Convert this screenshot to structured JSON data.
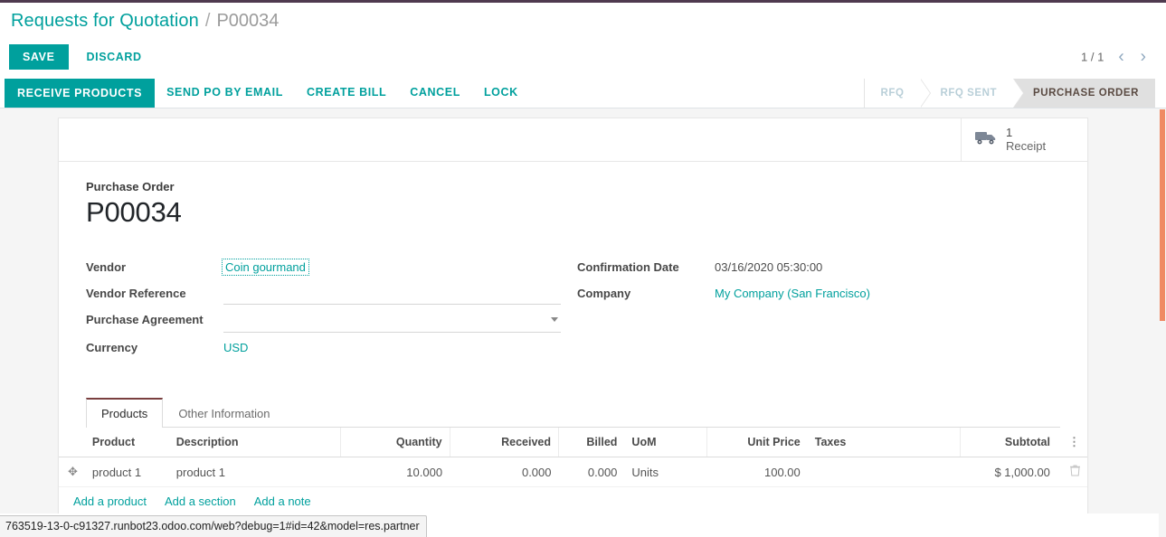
{
  "breadcrumb": {
    "parent": "Requests for Quotation",
    "separator": "/",
    "current": "P00034"
  },
  "controls": {
    "save_label": "SAVE",
    "discard_label": "DISCARD",
    "pager_text": "1 / 1",
    "prev_icon": "‹",
    "next_icon": "›"
  },
  "action_bar": {
    "buttons": [
      {
        "label": "RECEIVE PRODUCTS",
        "primary": true
      },
      {
        "label": "SEND PO BY EMAIL",
        "primary": false
      },
      {
        "label": "CREATE BILL",
        "primary": false
      },
      {
        "label": "CANCEL",
        "primary": false
      },
      {
        "label": "LOCK",
        "primary": false
      }
    ]
  },
  "statusbar": {
    "stages": [
      {
        "label": "RFQ",
        "active": false
      },
      {
        "label": "RFQ SENT",
        "active": false
      },
      {
        "label": "PURCHASE ORDER",
        "active": true
      }
    ]
  },
  "smart_buttons": [
    {
      "icon": "truck-icon",
      "value": "1",
      "label": "Receipt"
    }
  ],
  "title": {
    "label": "Purchase Order",
    "value": "P00034"
  },
  "form": {
    "left": [
      {
        "label": "Vendor",
        "value": "Coin gourmand",
        "type": "highlight-link"
      },
      {
        "label": "Vendor Reference",
        "value": "",
        "placeholder": "",
        "type": "input"
      },
      {
        "label": "Purchase Agreement",
        "value": "",
        "type": "select",
        "options": [
          ""
        ]
      },
      {
        "label": "Currency",
        "value": "USD",
        "type": "link"
      }
    ],
    "right": [
      {
        "label": "Confirmation Date",
        "value": "03/16/2020 05:30:00",
        "type": "text"
      },
      {
        "label": "Company",
        "value": "My Company (San Francisco)",
        "type": "link"
      }
    ]
  },
  "notebook": {
    "tabs": [
      {
        "label": "Products",
        "active": true
      },
      {
        "label": "Other Information",
        "active": false
      }
    ]
  },
  "lines_table": {
    "columns": [
      {
        "label": "Product",
        "align": "left"
      },
      {
        "label": "Description",
        "align": "left"
      },
      {
        "label": "Quantity",
        "align": "right"
      },
      {
        "label": "Received",
        "align": "right"
      },
      {
        "label": "Billed",
        "align": "right"
      },
      {
        "label": "UoM",
        "align": "left"
      },
      {
        "label": "Unit Price",
        "align": "right"
      },
      {
        "label": "Taxes",
        "align": "left"
      },
      {
        "label": "Subtotal",
        "align": "right"
      }
    ],
    "options_icon": "⋮",
    "rows": [
      {
        "handle_icon": "✥",
        "product": "product 1",
        "description": "product 1",
        "quantity": "10.000",
        "received": "0.000",
        "billed": "0.000",
        "uom": "Units",
        "unit_price": "100.00",
        "taxes": "",
        "subtotal": "$ 1,000.00",
        "delete_icon": "🗑"
      }
    ],
    "add_links": [
      {
        "label": "Add a product"
      },
      {
        "label": "Add a section"
      },
      {
        "label": "Add a note"
      }
    ]
  },
  "status_url": "763519-13-0-c91327.runbot23.odoo.com/web?debug=1#id=42&model=res.partner",
  "colors": {
    "accent": "#00a09d",
    "top_bar": "#4f3a4f",
    "scrollbar": "#ef8a64",
    "active_tab_border": "#7a3f3f",
    "stage_active_bg": "#e0e0e0"
  }
}
